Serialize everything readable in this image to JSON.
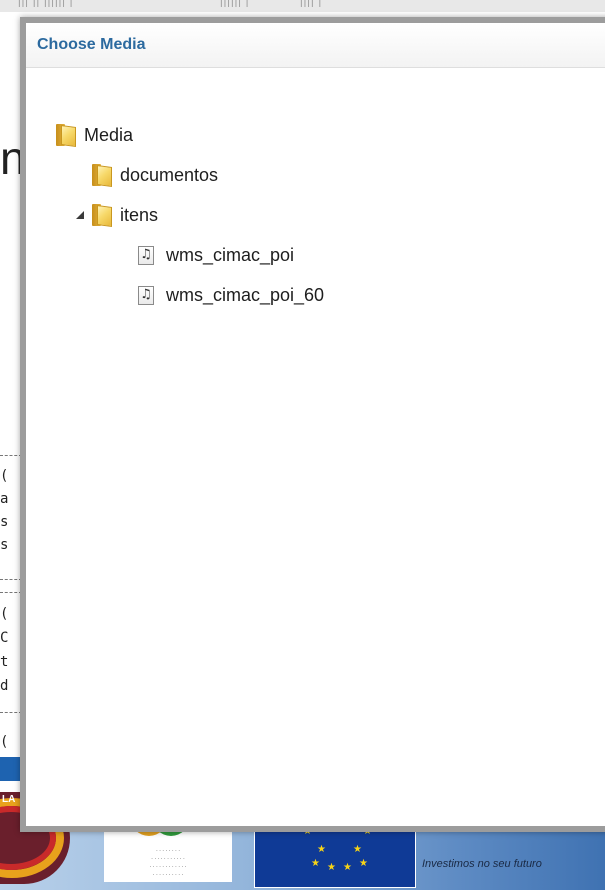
{
  "background": {
    "glyph": "n",
    "side_chars": [
      "(",
      "a",
      "s",
      "s",
      "(",
      "C",
      "t",
      "d",
      "("
    ],
    "logo_label": "LA",
    "tagline": "Investimos no seu futuro"
  },
  "dialog": {
    "title": "Choose Media",
    "tree": {
      "root": {
        "label": "Media",
        "icon": "folder-icon",
        "children": [
          {
            "label": "documentos",
            "icon": "folder-icon",
            "state": "collapsed"
          },
          {
            "label": "itens",
            "icon": "folder-icon",
            "state": "expanded",
            "children": [
              {
                "label": "wms_cimac_poi",
                "icon": "audio-file-icon"
              },
              {
                "label": "wms_cimac_poi_60",
                "icon": "audio-file-icon"
              }
            ]
          }
        ]
      }
    }
  },
  "colors": {
    "title": "#2c6a9f",
    "dialog_border": "#9c9c9c",
    "footer_blue": "#3f72b2",
    "eu_blue": "#0f3a96",
    "eu_star": "#f7d417"
  }
}
